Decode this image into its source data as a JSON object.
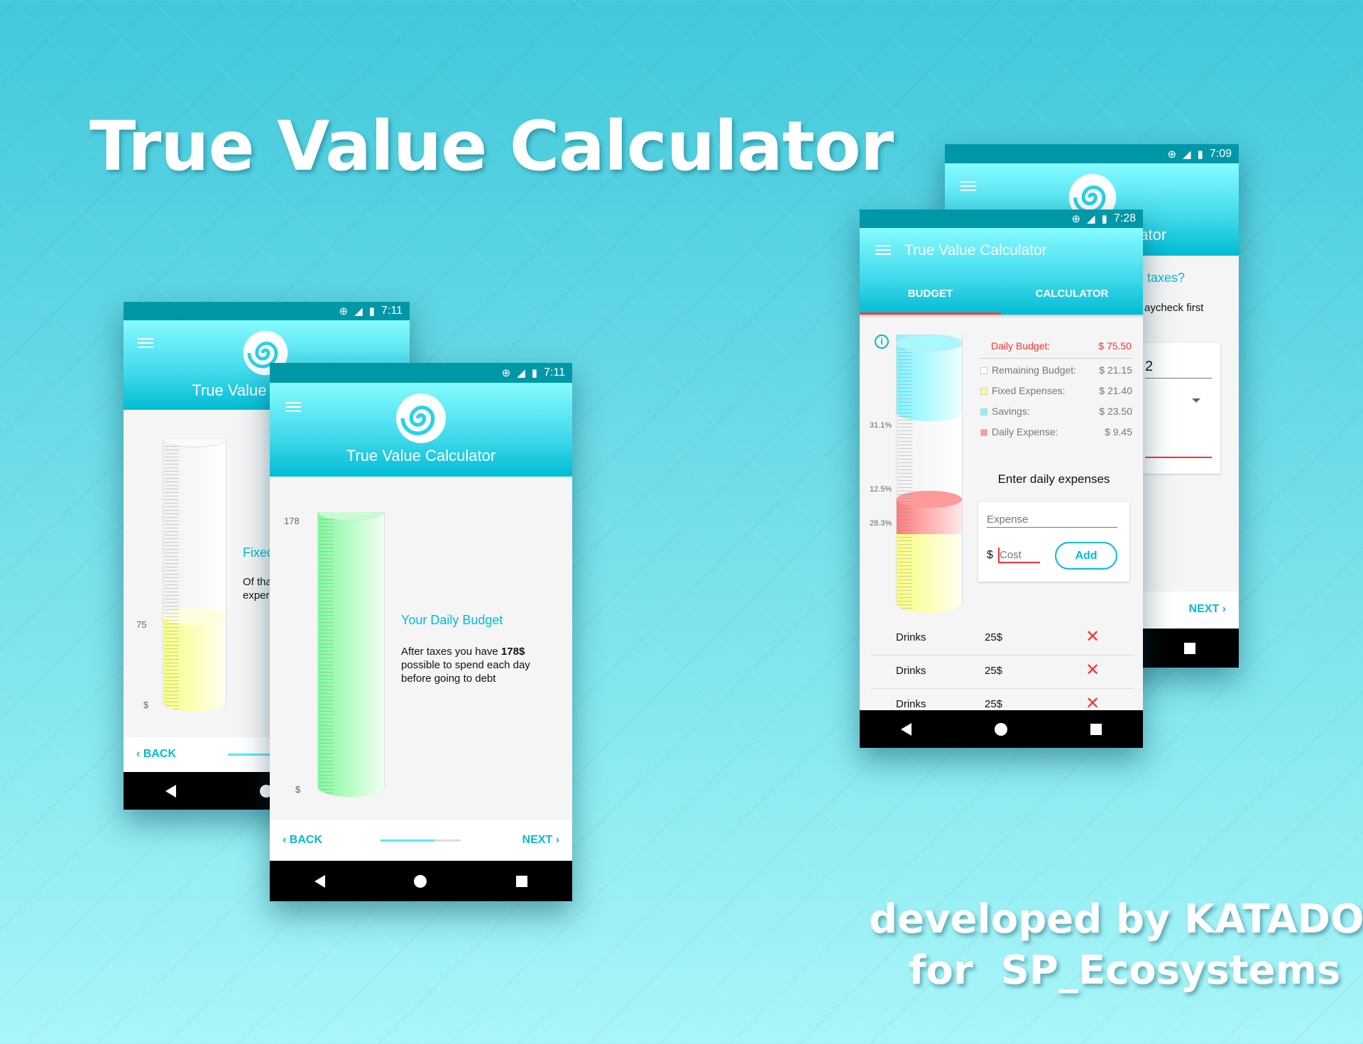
{
  "promo": {
    "title": "True Value Calculator",
    "footer_line1": "developed by KATADOR",
    "footer_line2": "for  SP_Ecosystems"
  },
  "colors": {
    "accent": "#00bcd4",
    "status_bar": "#0097a7",
    "error_red": "#ff3030",
    "fixed_yellow": "#fbff86",
    "savings_cyan": "#86f4ff",
    "expense_red": "#ff8a8a",
    "budget_green": "#86ff9e"
  },
  "status_icons": [
    "data-saver-icon",
    "4g-signal-icon",
    "battery-charging-icon"
  ],
  "phone_fixed": {
    "time": "7:11",
    "app_title": "True Value Calculator",
    "axis_top": "75",
    "axis_bottom": "$",
    "fill_percent": 35,
    "heading": "Fixed",
    "para_line1": "Of tha",
    "para_line2": "exper",
    "back": "BACK"
  },
  "phone_budget": {
    "time": "7:11",
    "app_title": "True Value Calculator",
    "axis_top": "178",
    "axis_bottom": "$",
    "fill_percent": 100,
    "heading": "Your Daily Budget",
    "para_pre": "After taxes you have ",
    "para_bold": "178$",
    "para_line2": "possible to spend each day",
    "para_line3": "before going to debt",
    "back": "BACK",
    "next": "NEXT",
    "progress_percent": 67
  },
  "phone_taxes": {
    "time": "7:09",
    "app_title": "True Value Calculator",
    "question": "taxes?",
    "hint": "aycheck first",
    "input_value": "2",
    "next": "NEXT"
  },
  "phone_main": {
    "time": "7:28",
    "app_title": "True Value Calculator",
    "tabs": [
      {
        "label": "BUDGET",
        "active": true
      },
      {
        "label": "CALCULATOR",
        "active": false
      }
    ],
    "gauge": {
      "savings_label": "31.1%",
      "expense_label": "12.5%",
      "fixed_label": "28.3%",
      "savings_percent": 31.1,
      "expense_percent": 12.5,
      "fixed_percent": 28.3
    },
    "daily_budget": {
      "label": "Daily Budget:",
      "value": "$ 75.50"
    },
    "legend": [
      {
        "label": "Remaining Budget:",
        "value": "$ 21.15",
        "swatch": "#ffffff"
      },
      {
        "label": "Fixed Expenses:",
        "value": "$ 21.40",
        "swatch": "#fbff86"
      },
      {
        "label": "Savings:",
        "value": "$ 23.50",
        "swatch": "#86f4ff"
      },
      {
        "label": "Daily Expense:",
        "value": "$ 9.45",
        "swatch": "#ff9a9a"
      }
    ],
    "form": {
      "heading": "Enter daily expenses",
      "expense_placeholder": "Expense",
      "currency": "$",
      "cost_placeholder": "Cost",
      "add": "Add"
    },
    "expenses": [
      {
        "name": "Drinks",
        "amount": "25$"
      },
      {
        "name": "Drinks",
        "amount": "25$"
      },
      {
        "name": "Drinks",
        "amount": "25$"
      }
    ]
  }
}
